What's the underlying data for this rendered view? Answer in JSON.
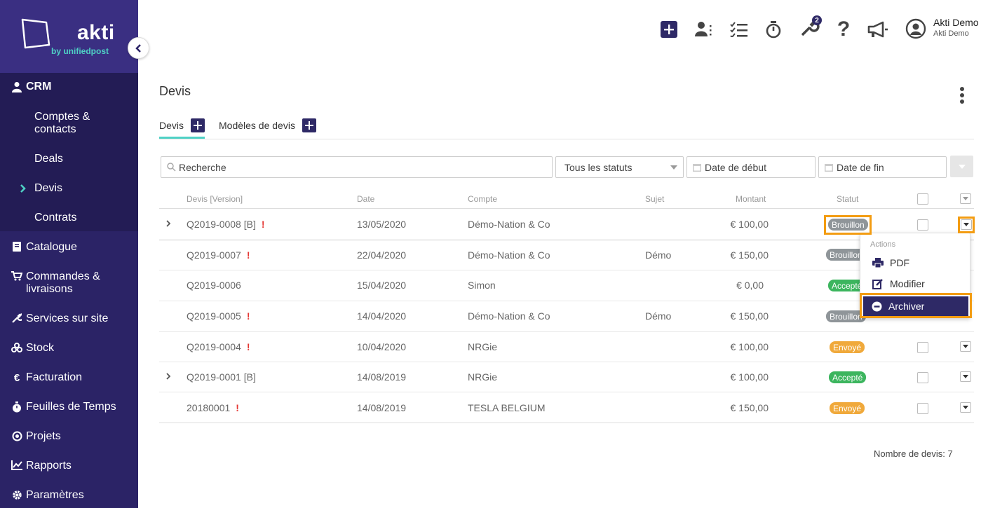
{
  "brand": {
    "name": "akti",
    "tagline": "by unifiedpost"
  },
  "sidebar": {
    "crm_label": "CRM",
    "crm_items": [
      {
        "label_line1": "Comptes &",
        "label_line2": "contacts"
      },
      {
        "label": "Deals"
      },
      {
        "label": "Devis",
        "active": true
      },
      {
        "label": "Contrats"
      }
    ],
    "items": [
      {
        "label": "Catalogue",
        "icon": "book-icon"
      },
      {
        "label_line1": "Commandes &",
        "label_line2": "livraisons",
        "icon": "cart-icon"
      },
      {
        "label": "Services sur site",
        "icon": "wrench-icon"
      },
      {
        "label": "Stock",
        "icon": "boxes-icon"
      },
      {
        "label": "Facturation",
        "icon": "euro-icon"
      },
      {
        "label": "Feuilles de Temps",
        "icon": "stopwatch-icon"
      },
      {
        "label": "Projets",
        "icon": "target-icon"
      },
      {
        "label": "Rapports",
        "icon": "chart-icon"
      },
      {
        "label": "Paramètres",
        "icon": "gear-icon"
      }
    ]
  },
  "topbar": {
    "notification_count": "2",
    "user_name": "Akti Demo",
    "user_company": "Akti Demo"
  },
  "page": {
    "title": "Devis",
    "tabs": [
      {
        "label": "Devis",
        "active": true
      },
      {
        "label": "Modèles de devis"
      }
    ]
  },
  "filters": {
    "search_placeholder": "Recherche",
    "status": "Tous les statuts",
    "start_placeholder": "Date de début",
    "end_placeholder": "Date de fin"
  },
  "table": {
    "headers": [
      "Devis [Version]",
      "Date",
      "Compte",
      "Sujet",
      "Montant",
      "Statut"
    ],
    "rows": [
      {
        "ref": "Q2019-0008 [B]",
        "flag": "!",
        "date": "13/05/2020",
        "account": "Démo-Nation & Co",
        "subject": "",
        "amount": "€ 100,00",
        "status": "Brouillon",
        "status_color": "#8f9599",
        "expandable": true
      },
      {
        "ref": "Q2019-0007",
        "flag": "!",
        "date": "22/04/2020",
        "account": "Démo-Nation & Co",
        "subject": "Démo",
        "amount": "€ 150,00",
        "status": "Brouillon",
        "status_color": "#8f9599",
        "expandable": false
      },
      {
        "ref": "Q2019-0006",
        "flag": "",
        "date": "15/04/2020",
        "account": "Simon",
        "subject": "",
        "amount": "€ 0,00",
        "status": "Accepté",
        "status_color": "#3cb55e",
        "expandable": false
      },
      {
        "ref": "Q2019-0005",
        "flag": "!",
        "date": "14/04/2020",
        "account": "Démo-Nation & Co",
        "subject": "Démo",
        "amount": "€ 150,00",
        "status": "Brouillon",
        "status_color": "#8f9599",
        "expandable": false
      },
      {
        "ref": "Q2019-0004",
        "flag": "!",
        "date": "10/04/2020",
        "account": "NRGie",
        "subject": "",
        "amount": "€ 100,00",
        "status": "Envoyé",
        "status_color": "#f0a93b",
        "expandable": false
      },
      {
        "ref": "Q2019-0001 [B]",
        "flag": "",
        "date": "14/08/2019",
        "account": "NRGie",
        "subject": "",
        "amount": "€ 100,00",
        "status": "Accepté",
        "status_color": "#3cb55e",
        "expandable": true
      },
      {
        "ref": "20180001",
        "flag": "!",
        "date": "14/08/2019",
        "account": "TESLA BELGIUM",
        "subject": "",
        "amount": "€ 150,00",
        "status": "Envoyé",
        "status_color": "#f0a93b",
        "expandable": false
      }
    ],
    "count_label": "Nombre de devis:",
    "count_value": "7"
  },
  "actions_menu": {
    "title": "Actions",
    "items": [
      {
        "label": "PDF",
        "icon": "printer-icon"
      },
      {
        "label": "Modifier",
        "icon": "edit-icon"
      },
      {
        "label": "Archiver",
        "icon": "minus-circle-icon",
        "highlighted": true
      }
    ]
  },
  "colors": {
    "sidebar": "#2b2366",
    "accent": "#4fd1c5",
    "primary": "#2e2966",
    "highlight": "#f39c12"
  }
}
